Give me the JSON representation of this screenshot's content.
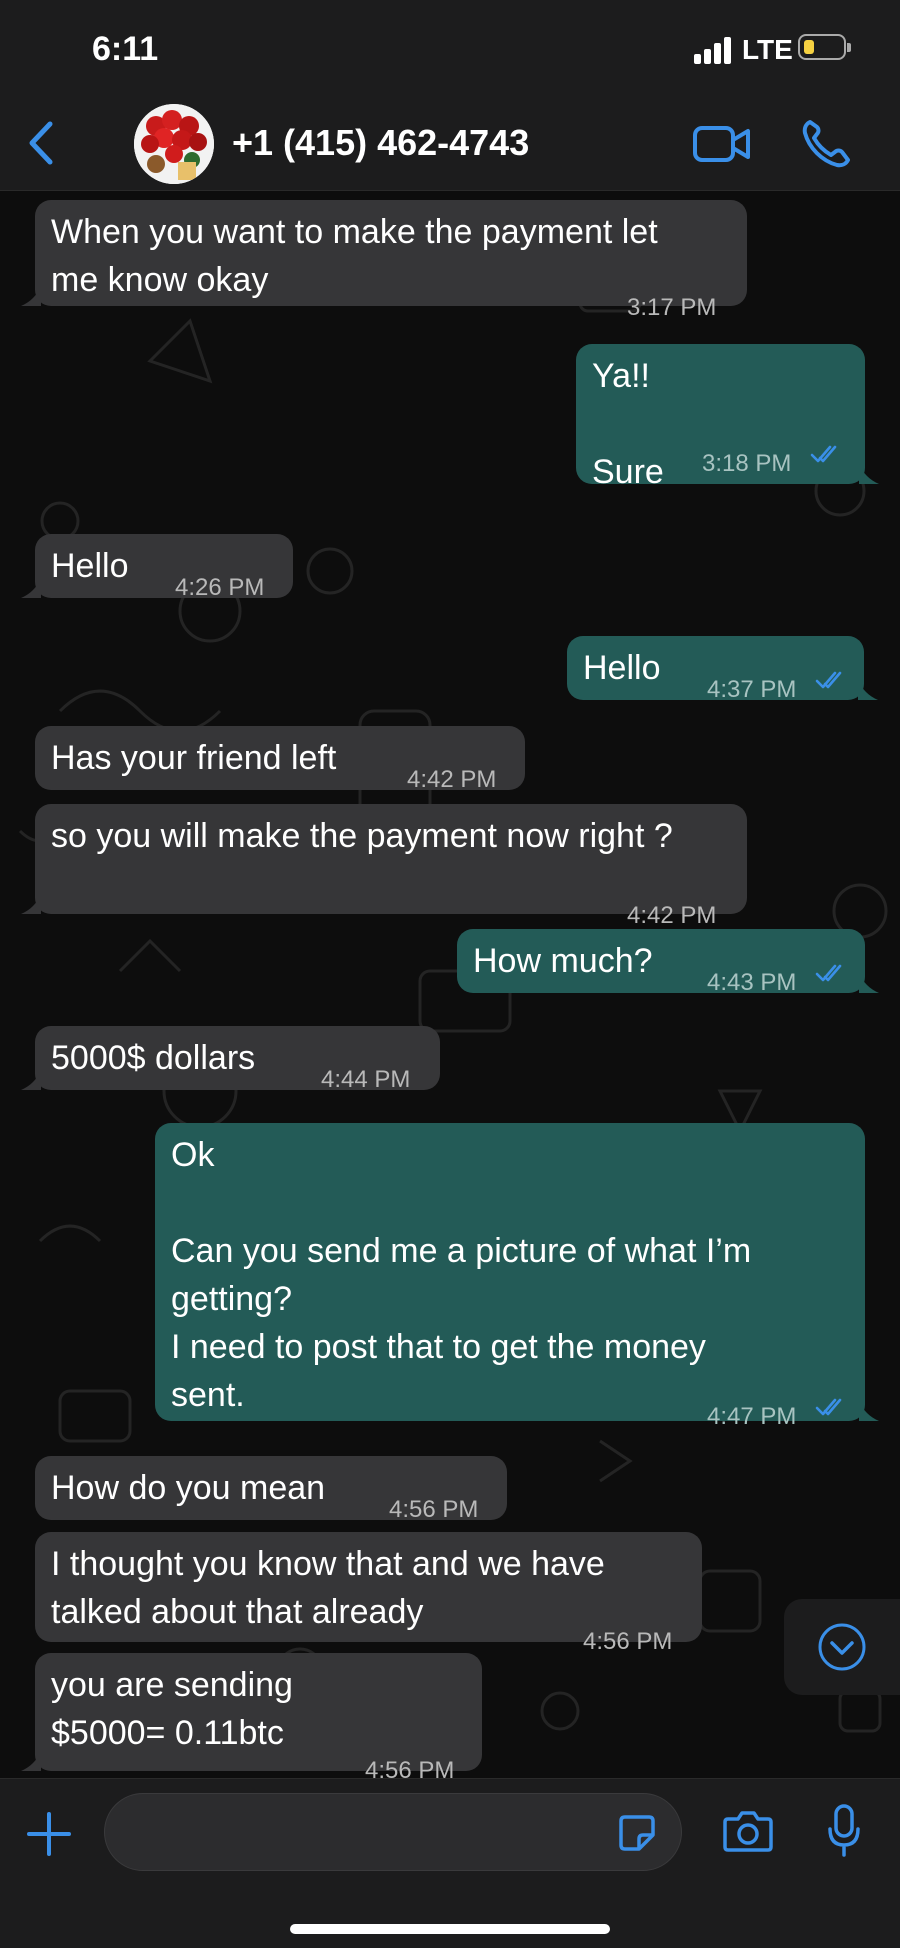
{
  "status_bar": {
    "time": "6:11",
    "network": "LTE"
  },
  "header": {
    "contact": "+1 (415) 462-4743"
  },
  "messages": [
    {
      "dir": "in",
      "text": "When you want to make the payment let\nme know okay",
      "time": "3:17 PM"
    },
    {
      "dir": "out",
      "text": "Ya!!\n\nSure",
      "time": "3:18 PM",
      "read": true
    },
    {
      "dir": "in",
      "text": "Hello",
      "time": "4:26 PM"
    },
    {
      "dir": "out",
      "text": "Hello",
      "time": "4:37 PM",
      "read": true
    },
    {
      "dir": "in",
      "text": "Has your friend left",
      "time": "4:42 PM"
    },
    {
      "dir": "in",
      "text": "so you will make the payment now right ?",
      "time": "4:42 PM"
    },
    {
      "dir": "out",
      "text": "How much?",
      "time": "4:43 PM",
      "read": true
    },
    {
      "dir": "in",
      "text": "5000$ dollars",
      "time": "4:44 PM"
    },
    {
      "dir": "out",
      "text": "Ok\n\nCan you send me a picture of what I’m\ngetting?\nI need to post that to get the money\nsent.",
      "time": "4:47 PM",
      "read": true
    },
    {
      "dir": "in",
      "text": "How do you mean",
      "time": "4:56 PM"
    },
    {
      "dir": "in",
      "text": "I thought you know that and we have\ntalked about that already",
      "time": "4:56 PM"
    },
    {
      "dir": "in",
      "text": "you are sending\n$5000= 0.11btc",
      "time": "4:56 PM"
    }
  ],
  "composer": {
    "placeholder": ""
  },
  "colors": {
    "accent": "#3a8fe8",
    "incoming": "#363638",
    "outgoing": "#235b57",
    "bar": "#1c1c1d"
  },
  "icons": [
    "back-chevron-icon",
    "video-call-icon",
    "phone-call-icon",
    "scroll-down-icon",
    "plus-icon",
    "sticker-icon",
    "camera-icon",
    "microphone-icon"
  ]
}
